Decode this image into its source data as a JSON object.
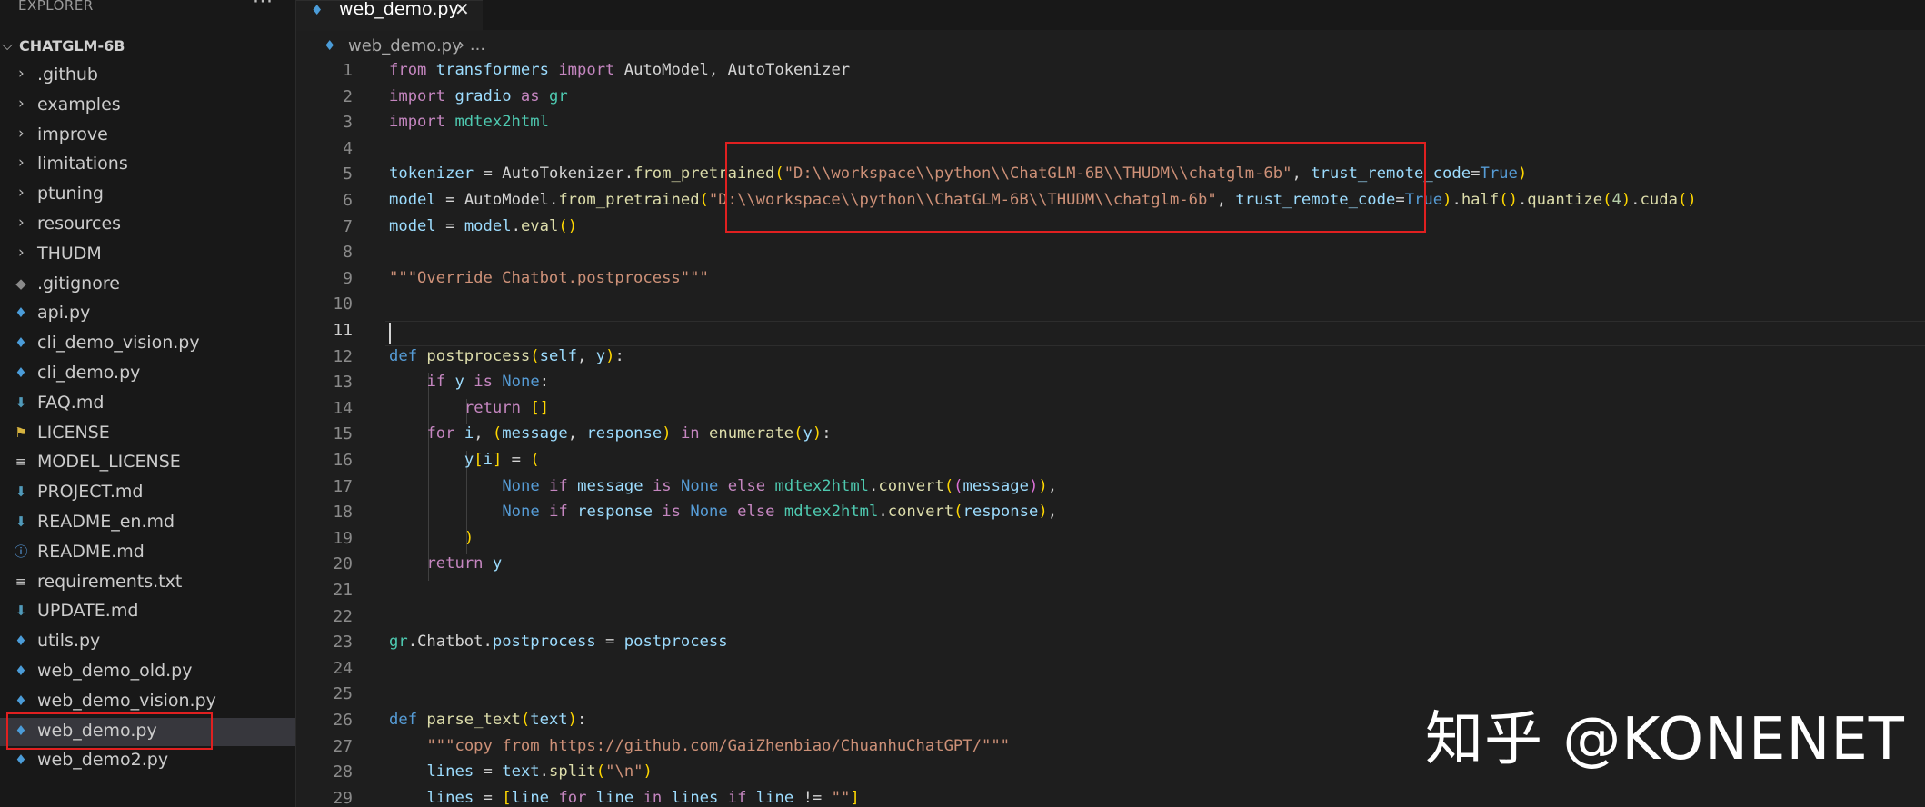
{
  "explorer": {
    "header": "EXPLORER",
    "more": "···",
    "root": "CHATGLM-6B",
    "items": [
      {
        "label": ".github",
        "kind": "folder"
      },
      {
        "label": "examples",
        "kind": "folder"
      },
      {
        "label": "improve",
        "kind": "folder"
      },
      {
        "label": "limitations",
        "kind": "folder"
      },
      {
        "label": "ptuning",
        "kind": "folder"
      },
      {
        "label": "resources",
        "kind": "folder"
      },
      {
        "label": "THUDM",
        "kind": "folder"
      },
      {
        "label": ".gitignore",
        "kind": "git-icon"
      },
      {
        "label": "api.py",
        "kind": "python-icon"
      },
      {
        "label": "cli_demo_vision.py",
        "kind": "python-icon"
      },
      {
        "label": "cli_demo.py",
        "kind": "python-icon"
      },
      {
        "label": "FAQ.md",
        "kind": "markdown-icon"
      },
      {
        "label": "LICENSE",
        "kind": "license-icon"
      },
      {
        "label": "MODEL_LICENSE",
        "kind": "lines-icon"
      },
      {
        "label": "PROJECT.md",
        "kind": "markdown-icon"
      },
      {
        "label": "README_en.md",
        "kind": "markdown-icon"
      },
      {
        "label": "README.md",
        "kind": "info-icon"
      },
      {
        "label": "requirements.txt",
        "kind": "lines-icon"
      },
      {
        "label": "UPDATE.md",
        "kind": "markdown-icon"
      },
      {
        "label": "utils.py",
        "kind": "python-icon"
      },
      {
        "label": "web_demo_old.py",
        "kind": "python-icon"
      },
      {
        "label": "web_demo_vision.py",
        "kind": "python-icon"
      },
      {
        "label": "web_demo.py",
        "kind": "python-icon",
        "selected": true
      },
      {
        "label": "web_demo2.py",
        "kind": "python-icon"
      }
    ]
  },
  "tab": {
    "label": "web_demo.py",
    "close": "✕"
  },
  "breadcrumb": {
    "file": "web_demo.py",
    "sep": "› ..."
  },
  "editor": {
    "current_line": 11,
    "lines": [
      "from transformers import AutoModel, AutoTokenizer",
      "import gradio as gr",
      "import mdtex2html",
      "",
      "tokenizer = AutoTokenizer.from_pretrained(\"D:\\\\workspace\\\\python\\\\ChatGLM-6B\\\\THUDM\\\\chatglm-6b\", trust_remote_code=True)",
      "model = AutoModel.from_pretrained(\"D:\\\\workspace\\\\python\\\\ChatGLM-6B\\\\THUDM\\\\chatglm-6b\", trust_remote_code=True).half().quantize(4).cuda()",
      "model = model.eval()",
      "",
      "\"\"\"Override Chatbot.postprocess\"\"\"",
      "",
      "",
      "def postprocess(self, y):",
      "    if y is None:",
      "        return []",
      "    for i, (message, response) in enumerate(y):",
      "        y[i] = (",
      "            None if message is None else mdtex2html.convert((message)),",
      "            None if response is None else mdtex2html.convert(response),",
      "        )",
      "    return y",
      "",
      "",
      "gr.Chatbot.postprocess = postprocess",
      "",
      "",
      "def parse_text(text):",
      "    \"\"\"copy from https://github.com/GaiZhenbiao/ChuanhuChatGPT/\"\"\"",
      "    lines = text.split(\"\\n\")",
      "    lines = [line for line in lines if line != \"\"]"
    ]
  },
  "watermark": "知乎 @KONENET",
  "colors": {
    "highlight_box": "#e02020",
    "editor_bg": "#1e1e1e",
    "sidebar_bg": "#181818"
  }
}
